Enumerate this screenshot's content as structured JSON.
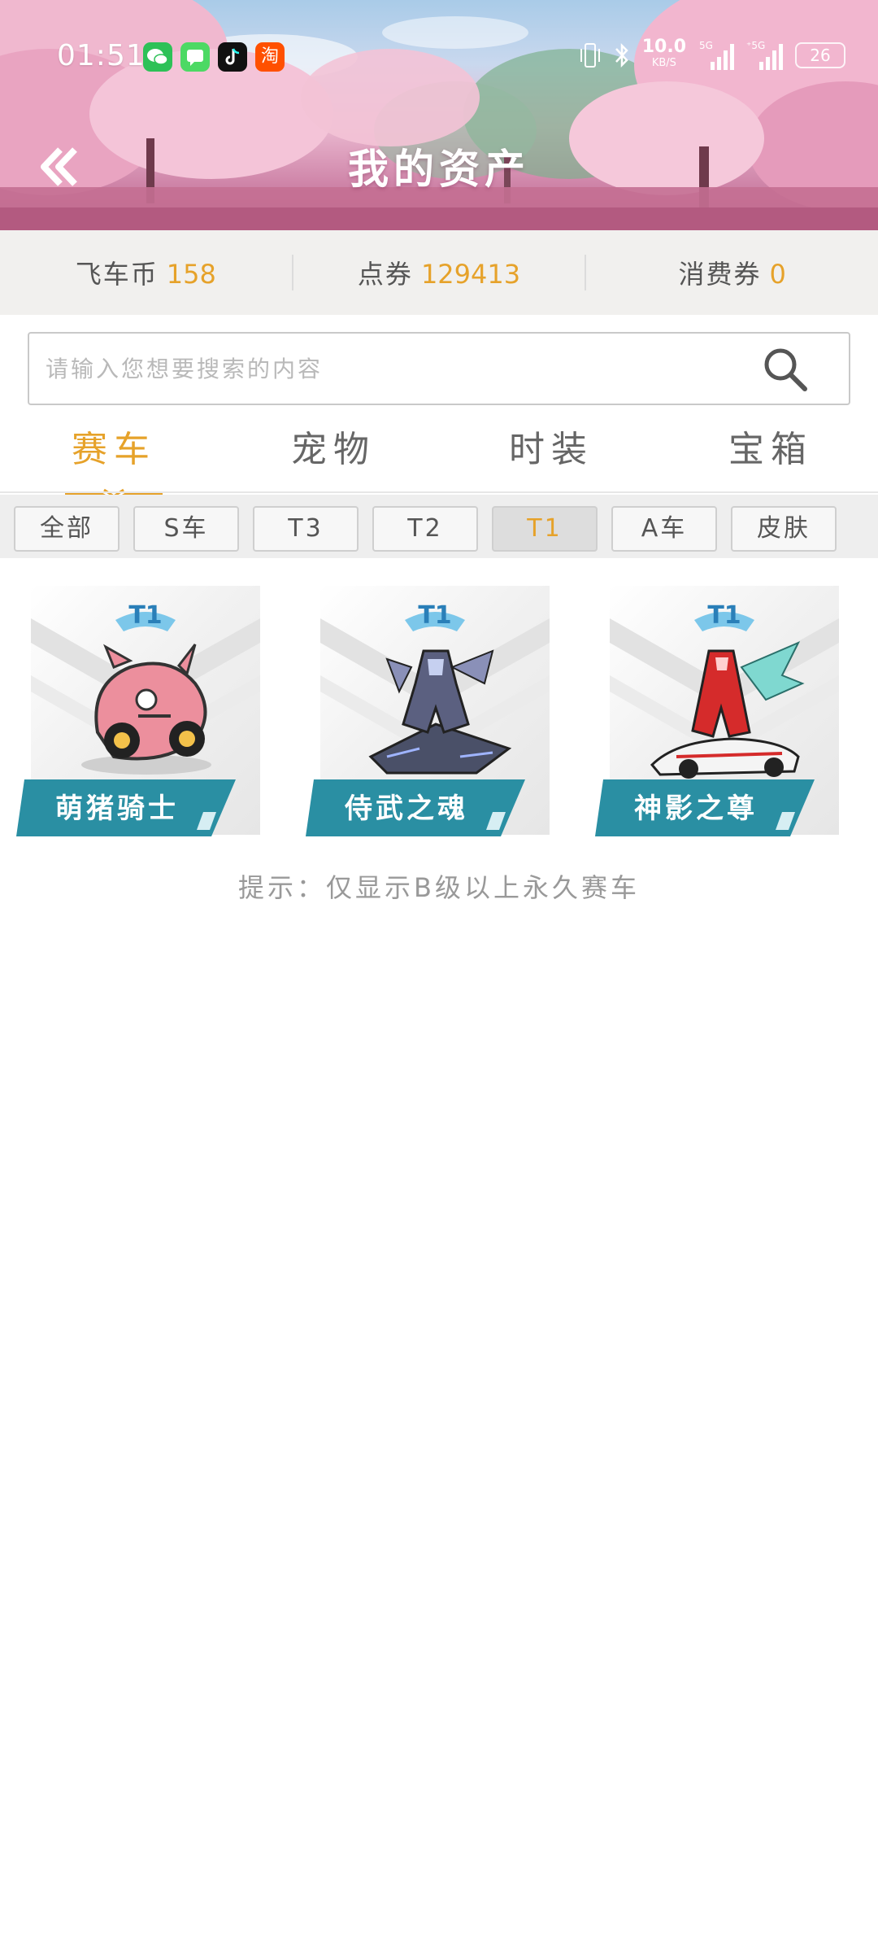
{
  "status_bar": {
    "time": "01:51",
    "app_icons": [
      "wechat-icon",
      "messages-icon",
      "tiktok-icon",
      "taobao-icon"
    ],
    "taobao_glyph": "淘",
    "net_speed": "10.0",
    "net_unit": "KB/S",
    "battery": "26"
  },
  "header": {
    "title": "我的资产"
  },
  "currency": {
    "items": [
      {
        "label": "飞车币",
        "value": "158"
      },
      {
        "label": "点券",
        "value": "129413"
      },
      {
        "label": "消费券",
        "value": "0"
      }
    ]
  },
  "search": {
    "placeholder": "请输入您想要搜索的内容"
  },
  "tabs": [
    {
      "label": "赛车",
      "active": true
    },
    {
      "label": "宠物",
      "active": false
    },
    {
      "label": "时装",
      "active": false
    },
    {
      "label": "宝箱",
      "active": false
    }
  ],
  "filters": [
    {
      "label": "全部",
      "active": false
    },
    {
      "label": "S车",
      "active": false
    },
    {
      "label": "T3",
      "active": false
    },
    {
      "label": "T2",
      "active": false
    },
    {
      "label": "T1",
      "active": true
    },
    {
      "label": "A车",
      "active": false
    },
    {
      "label": "皮肤",
      "active": false
    }
  ],
  "cards": [
    {
      "name": "萌猪骑士",
      "tier": "T1"
    },
    {
      "name": "侍武之魂",
      "tier": "T1"
    },
    {
      "name": "神影之尊",
      "tier": "T1"
    }
  ],
  "hint": "提示：仅显示B级以上永久赛车",
  "colors": {
    "accent": "#e6a22a",
    "card_bar": "#2a8fa3",
    "tier_badge": "#3aa3d8"
  }
}
